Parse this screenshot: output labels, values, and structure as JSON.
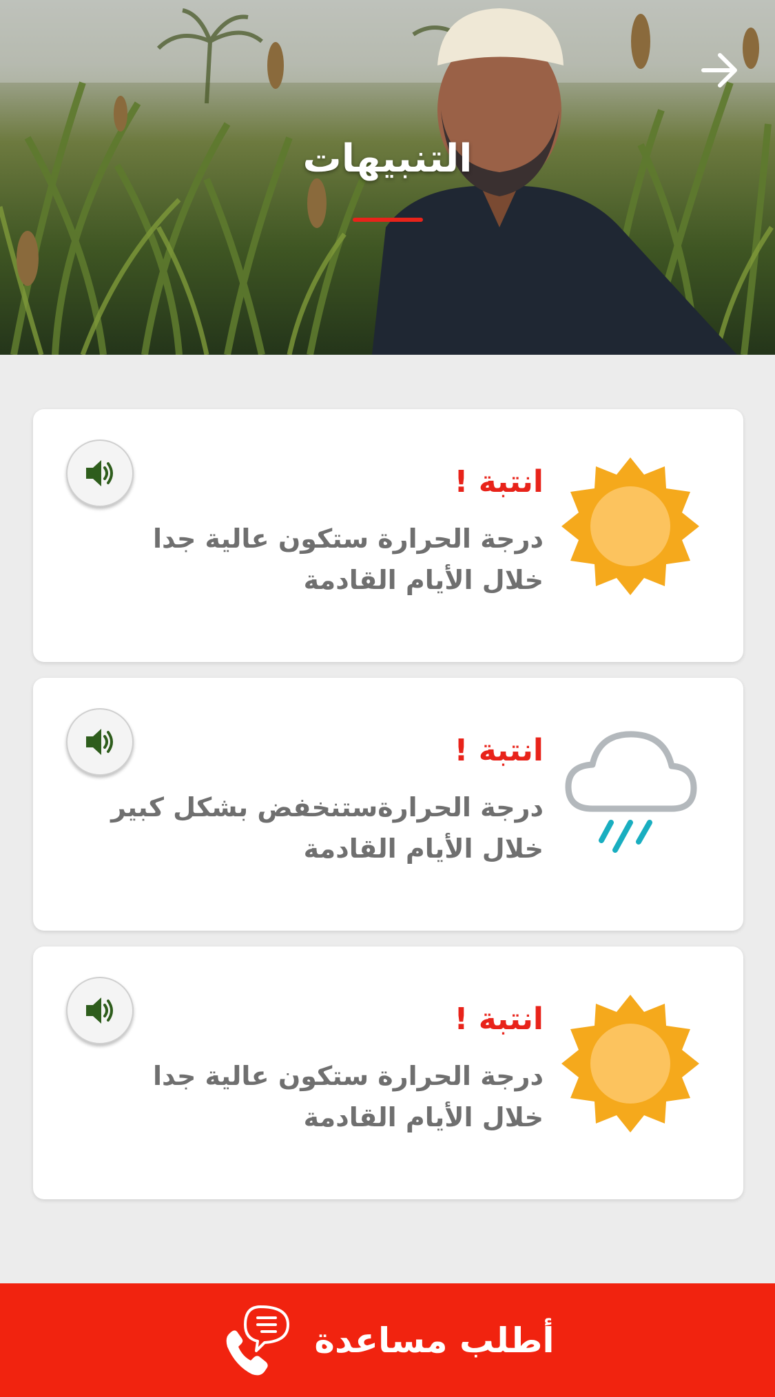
{
  "header": {
    "title": "التنبيهات",
    "back_icon": "arrow-right-icon"
  },
  "alerts": [
    {
      "title": "انتبة !",
      "text": "درجة الحرارة ستكون عالية جدا خلال الأيام القادمة",
      "icon": "sun-icon",
      "audio_icon": "speaker-icon"
    },
    {
      "title": "انتبة !",
      "text": "درجة الحرارةستنخفض بشكل كبير خلال الأيام القادمة",
      "icon": "rain-cloud-icon",
      "audio_icon": "speaker-icon"
    },
    {
      "title": "انتبة !",
      "text": "درجة الحرارة ستكون عالية جدا خلال الأيام القادمة",
      "icon": "sun-icon",
      "audio_icon": "speaker-icon"
    }
  ],
  "help_button": {
    "label": "أطلب مساعدة",
    "icon": "phone-chat-icon"
  },
  "colors": {
    "accent_red": "#f1230f",
    "alert_red": "#e8231a",
    "sun_outer": "#f5a91c",
    "sun_inner": "#fcc35e",
    "cloud": "#b3b8bc",
    "rain": "#19aec0",
    "speaker": "#2e5d1c"
  }
}
